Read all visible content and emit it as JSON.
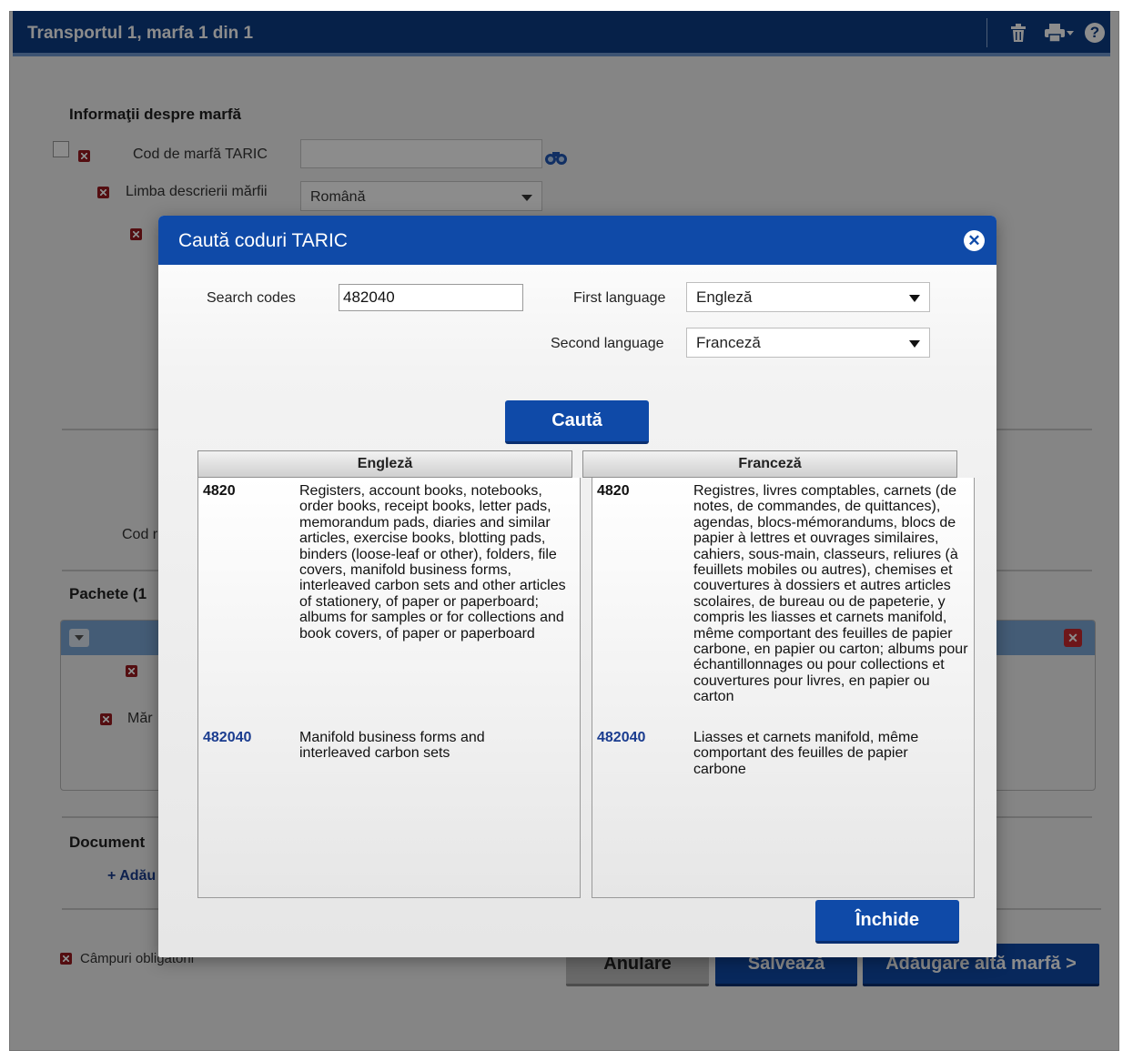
{
  "page": {
    "title": "Transportul 1, marfa 1 din 1",
    "section_goods_info": "Informaţii despre marfă",
    "taric_label": "Cod de marfă TARIC",
    "desc_lang_label": "Limba descrierii mărfii",
    "desc_lang_value": "Română",
    "cod_partial": "Cod r",
    "packages_partial": "Pachete (1",
    "marci_partial": "Măr",
    "documents_partial": "Document",
    "add_partial": "+ Adău",
    "required_note": "Câmpuri obligatorii",
    "cancel_button": "Anulare",
    "save_button": "Salvează",
    "add_another_button": "Adăugare altă marfă >"
  },
  "modal": {
    "title": "Caută coduri TARIC",
    "search_label": "Search codes",
    "search_value": "482040",
    "first_language_label": "First language",
    "first_language_value": "Engleză",
    "second_language_label": "Second language",
    "second_language_value": "Franceză",
    "search_button": "Caută",
    "close_button": "Închide",
    "results": {
      "col1_header": "Engleză",
      "col2_header": "Franceză",
      "col1_rows": [
        {
          "code": "4820",
          "desc": "Registers, account books, notebooks, order books, receipt books, letter pads, memorandum pads, diaries and similar articles, exercise books, blotting pads, binders (loose-leaf or other), folders, file covers, manifold business forms, interleaved carbon sets and other articles of stationery, of paper or paperboard; albums for samples or for collections and book covers, of paper or paperboard"
        },
        {
          "code": "482040",
          "desc": "Manifold business forms and interleaved carbon sets"
        }
      ],
      "col2_rows": [
        {
          "code": "4820",
          "desc": "Registres, livres comptables, carnets (de notes, de commandes, de quittances), agendas, blocs-mémorandums, blocs de papier à lettres et ouvrages similaires, cahiers, sous-main, classeurs, reliures (à feuillets mobiles ou autres), chemises et couvertures à dossiers et autres articles scolaires, de bureau ou de papeterie, y compris les liasses et carnets manifold, même comportant des feuilles de papier carbone, en papier ou carton; albums pour échantillonnages ou pour collections et couvertures pour livres, en papier ou carton"
        },
        {
          "code": "482040",
          "desc": "Liasses et carnets manifold, même comportant des feuilles de papier carbone"
        }
      ]
    }
  },
  "icons": {
    "header": [
      "trash-icon",
      "print-icon",
      "help-icon"
    ],
    "binoculars": "binoculars-icon",
    "close": "close-icon"
  },
  "colors": {
    "header_blue": "#0b3c86",
    "button_blue": "#0f4aa8",
    "required_red": "#9a1a1f",
    "code_link": "#1a3c8f"
  }
}
